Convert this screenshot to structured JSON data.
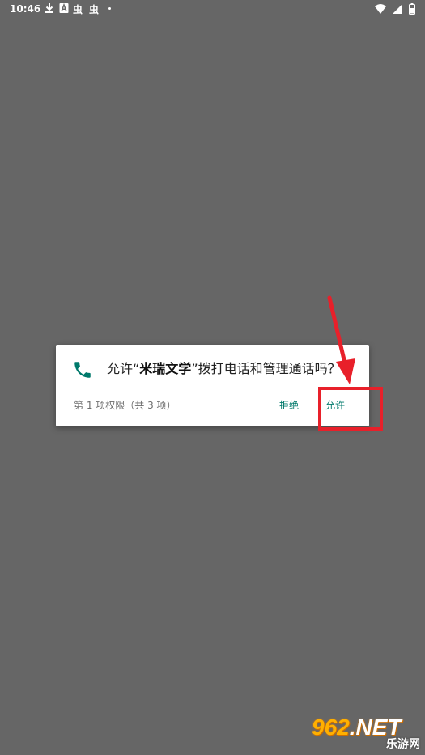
{
  "status_bar": {
    "time": "10:46",
    "icons": [
      "download-icon",
      "a-icon",
      "bug-icon",
      "bug-icon",
      "dot",
      "wifi-icon",
      "signal-icon",
      "battery-icon"
    ],
    "bug_glyph": "虫"
  },
  "dialog": {
    "title_prefix": "允许“",
    "app_name": "米瑞文学",
    "title_suffix": "”拨打电话和管理通话吗？",
    "counter": "第 1 项权限（共 3 项）",
    "deny_label": "拒绝",
    "allow_label": "允许",
    "icon": "phone-icon",
    "accent_color": "#00796b"
  },
  "annotation": {
    "color": "#e8202a"
  },
  "watermark": {
    "brand_number": "962",
    "brand_suffix": ".NET",
    "brand_cn": "乐游网"
  }
}
